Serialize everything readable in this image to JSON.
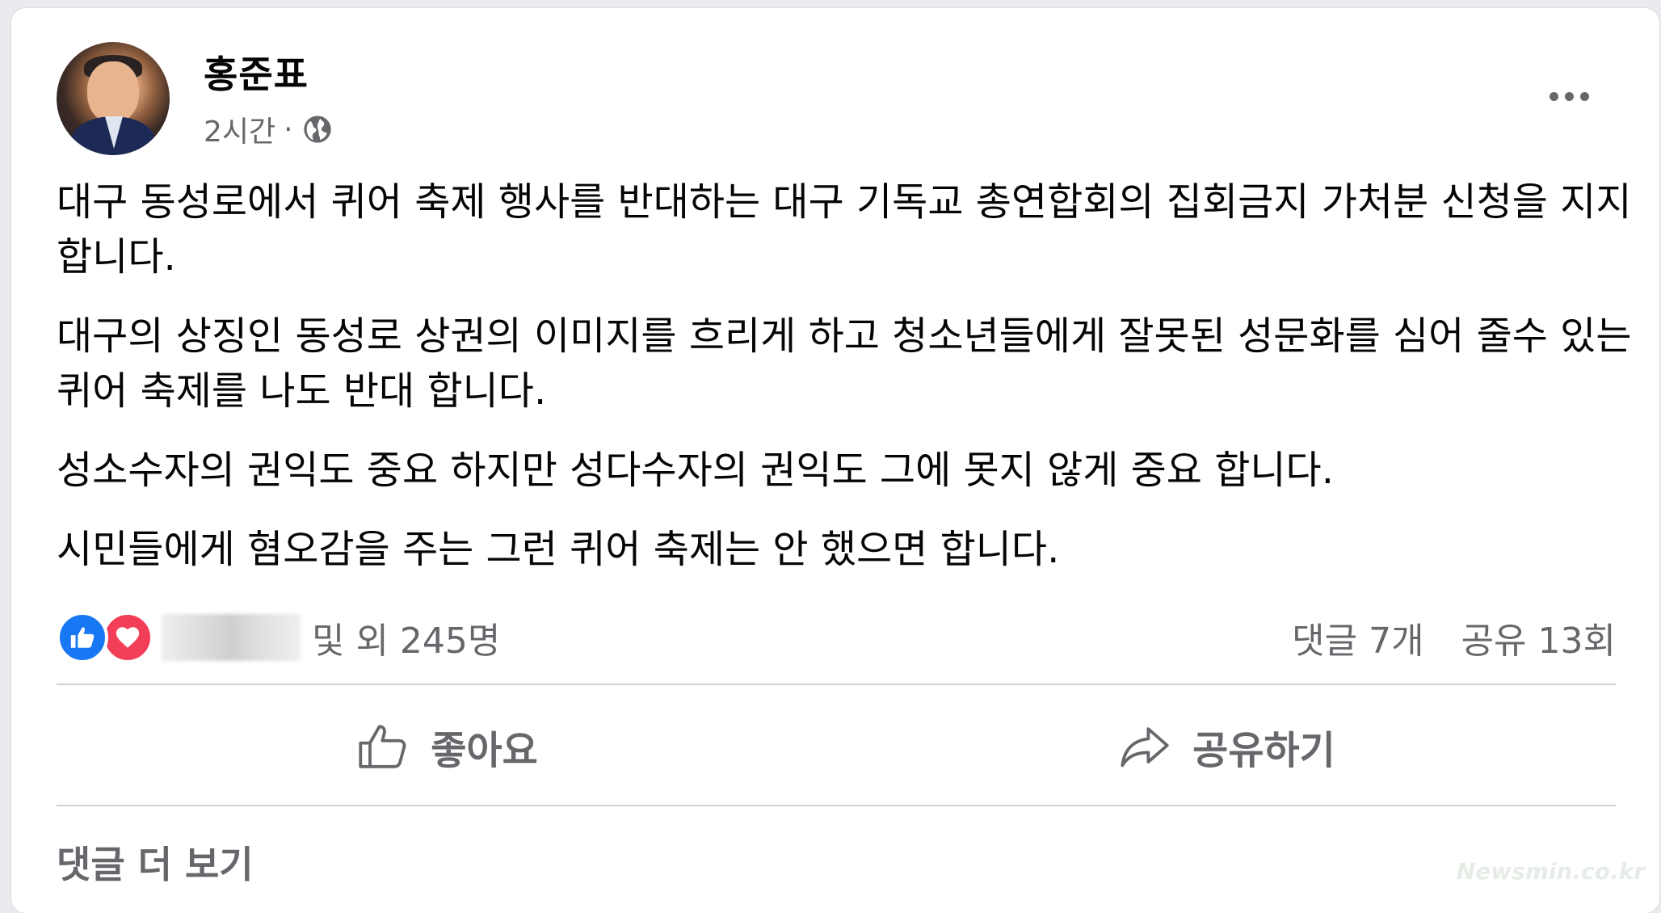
{
  "post": {
    "author": "홍준표",
    "time": "2시간",
    "separator": "·",
    "privacy_icon": "globe-icon",
    "paragraphs": [
      "대구 동성로에서 퀴어 축제 행사를 반대하는 대구 기독교 총연합회의 집회금지 가처분 신청을 지지 합니다.",
      "대구의 상징인 동성로 상권의 이미지를 흐리게 하고 청소년들에게 잘못된 성문화를 심어 줄수 있는 퀴어 축제를 나도 반대 합니다.",
      "성소수자의 권익도 중요 하지만 성다수자의 권익도 그에 못지 않게 중요 합니다.",
      "시민들에게 혐오감을 주는 그런 퀴어 축제는 안 했으면 합니다."
    ]
  },
  "reactions": {
    "icons": [
      "like-icon",
      "heart-icon"
    ],
    "text": "및 외 245명",
    "comments": "댓글 7개",
    "shares": "공유 13회"
  },
  "actions": {
    "like_label": "좋아요",
    "share_label": "공유하기"
  },
  "footer": {
    "more_comments": "댓글 더 보기",
    "watermark": "Newsmin.co.kr"
  },
  "colors": {
    "like_blue": "#1877f2",
    "love_red": "#f33e58",
    "secondary_text": "#65676b",
    "primary_text": "#050505"
  }
}
